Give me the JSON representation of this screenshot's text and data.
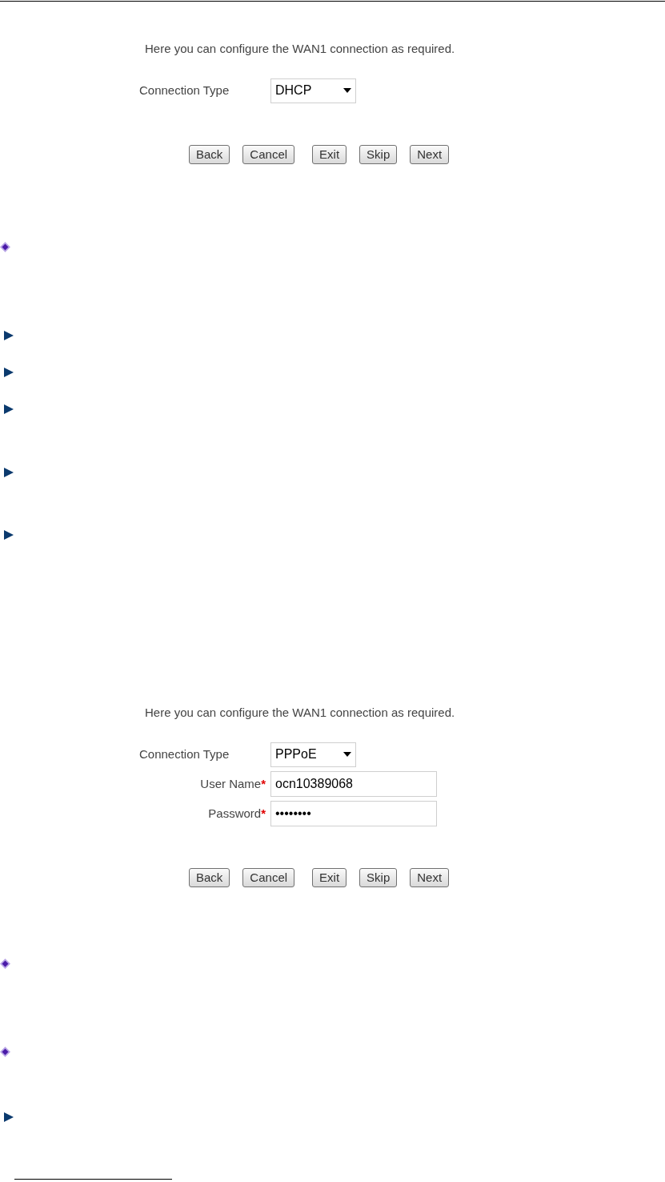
{
  "blocks": [
    {
      "kind": "form",
      "intro": "Here you can configure the WAN1 connection as required.",
      "fields": [
        {
          "kind": "select",
          "label": "Connection Type",
          "value": "DHCP"
        }
      ],
      "buttons": [
        "Back",
        "Cancel",
        "Exit",
        "Skip",
        "Next"
      ]
    },
    {
      "kind": "diamond"
    },
    {
      "kind": "arrow"
    },
    {
      "kind": "arrow"
    },
    {
      "kind": "arrow"
    },
    {
      "kind": "arrow"
    },
    {
      "kind": "arrow"
    },
    {
      "kind": "form",
      "intro": "Here you can configure the WAN1 connection as required.",
      "fields": [
        {
          "kind": "select",
          "label": "Connection Type",
          "value": "PPPoE"
        },
        {
          "kind": "text",
          "label": "User Name",
          "required_mark": "*",
          "value": "ocn10389068"
        },
        {
          "kind": "password",
          "label": "Password",
          "required_mark": "*",
          "value": "••••••••"
        }
      ],
      "buttons": [
        "Back",
        "Cancel",
        "Exit",
        "Skip",
        "Next"
      ]
    },
    {
      "kind": "diamond"
    },
    {
      "kind": "diamond"
    },
    {
      "kind": "arrow"
    }
  ]
}
